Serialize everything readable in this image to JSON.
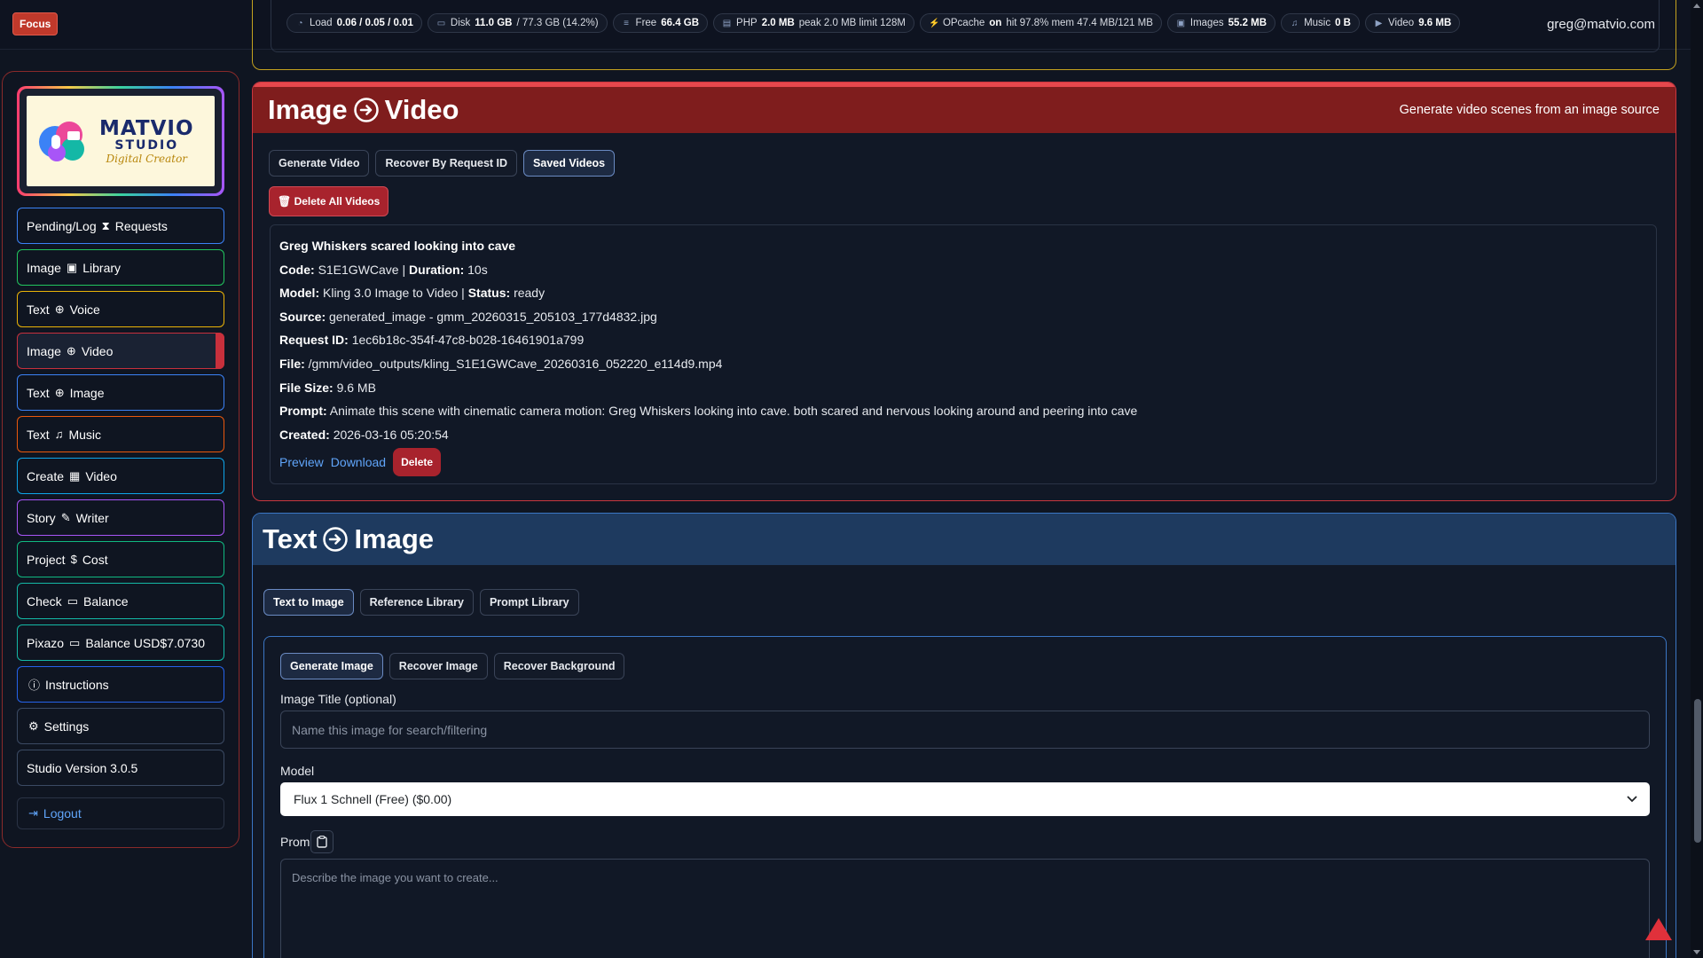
{
  "topbar": {
    "focus_label": "Focus",
    "stats": [
      {
        "icon": "gauge-icon",
        "label": "Load",
        "value": "0.06 / 0.05 / 0.01",
        "suffix": ""
      },
      {
        "icon": "disk-icon",
        "label": "Disk",
        "value": "11.0 GB",
        "suffix": "/ 77.3 GB (14.2%)"
      },
      {
        "icon": "database-icon",
        "label": "Free",
        "value": "66.4 GB",
        "suffix": ""
      },
      {
        "icon": "memory-icon",
        "label": "PHP",
        "value": "2.0 MB",
        "suffix": "peak 2.0 MB limit 128M"
      },
      {
        "icon": "bolt-icon",
        "label": "OPcache",
        "value": "on",
        "suffix": "hit 97.8% mem 47.4 MB/121 MB"
      },
      {
        "icon": "images-icon",
        "label": "Images",
        "value": "55.2 MB",
        "suffix": ""
      },
      {
        "icon": "music-icon",
        "label": "Music",
        "value": "0 B",
        "suffix": ""
      },
      {
        "icon": "video-icon",
        "label": "Video",
        "value": "9.6 MB",
        "suffix": ""
      }
    ],
    "user_email": "greg@matvio.com"
  },
  "logo": {
    "title": "MATVIO",
    "subtitle": "STUDIO",
    "script": "Digital Creator"
  },
  "sidebar": {
    "items": [
      {
        "a": "Pending/Log",
        "icon": "hourglass-icon",
        "glyph": "⧗",
        "b": "Requests"
      },
      {
        "a": "Image",
        "icon": "images-icon",
        "glyph": "▣",
        "b": "Library"
      },
      {
        "a": "Text",
        "icon": "arrow-circle-icon",
        "glyph": "⊕",
        "b": "Voice"
      },
      {
        "a": "Image",
        "icon": "arrow-circle-icon",
        "glyph": "⊕",
        "b": "Video"
      },
      {
        "a": "Text",
        "icon": "arrow-circle-icon",
        "glyph": "⊕",
        "b": "Image"
      },
      {
        "a": "Text",
        "icon": "music-list-icon",
        "glyph": "♫",
        "b": "Music"
      },
      {
        "a": "Create",
        "icon": "film-icon",
        "glyph": "▦",
        "b": "Video"
      },
      {
        "a": "Story",
        "icon": "edit-icon",
        "glyph": "✎",
        "b": "Writer"
      },
      {
        "a": "Project",
        "icon": "dollar-icon",
        "glyph": "$",
        "b": "Cost"
      },
      {
        "a": "Check",
        "icon": "wallet-icon",
        "glyph": "▭",
        "b": "Balance"
      },
      {
        "a": "Pixazo",
        "icon": "wallet-icon",
        "glyph": "▭",
        "b": "Balance USD$7.0730"
      },
      {
        "a": "",
        "icon": "info-icon",
        "glyph": "ⓘ",
        "b": "Instructions"
      },
      {
        "a": "",
        "icon": "gear-icon",
        "glyph": "⚙",
        "b": "Settings"
      },
      {
        "a": "Studio Version 3.0.5",
        "icon": "",
        "glyph": "",
        "b": ""
      },
      {
        "a": "",
        "icon": "logout-icon",
        "glyph": "⇥",
        "b": "Logout"
      }
    ]
  },
  "image_video": {
    "title_a": "Image",
    "title_b": "Video",
    "description": "Generate video scenes from an image source",
    "tabs": [
      "Generate Video",
      "Recover By Request ID",
      "Saved Videos"
    ],
    "delete_all_label": "Delete All Videos",
    "video": {
      "name": "Greg Whiskers scared looking into cave",
      "code_label": "Code:",
      "code": "S1E1GWCave",
      "duration_label": "Duration:",
      "duration": "10s",
      "model_label": "Model:",
      "model": "Kling 3.0 Image to Video",
      "status_label": "Status:",
      "status": "ready",
      "source_label": "Source:",
      "source": "generated_image - gmm_20260315_205103_177d4832.jpg",
      "request_label": "Request ID:",
      "request_id": "1ec6b18c-354f-47c8-b028-16461901a799",
      "file_label": "File:",
      "file": "/gmm/video_outputs/kling_S1E1GWCave_20260316_052220_e114d9.mp4",
      "size_label": "File Size:",
      "size": "9.6 MB",
      "prompt_label": "Prompt:",
      "prompt": "Animate this scene with cinematic camera motion: Greg Whiskers looking into cave. both scared and nervous looking around and peering into cave",
      "created_label": "Created:",
      "created": "2026-03-16 05:20:54",
      "preview_label": "Preview",
      "download_label": "Download",
      "delete_label": "Delete"
    }
  },
  "text_image": {
    "title_a": "Text",
    "title_b": "Image",
    "tabs": [
      "Text to Image",
      "Reference Library",
      "Prompt Library"
    ],
    "sub_tabs": [
      "Generate Image",
      "Recover Image",
      "Recover Background"
    ],
    "title_field_label": "Image Title (optional)",
    "title_placeholder": "Name this image for search/filtering",
    "model_label": "Model",
    "model_value": "Flux 1 Schnell (Free) ($0.00)",
    "prompt_label": "Prompt",
    "prompt_placeholder": "Describe the image you want to create..."
  },
  "colors": {
    "accent_red": "#c9363e",
    "accent_blue": "#3b76c4",
    "link": "#60a5fa"
  }
}
